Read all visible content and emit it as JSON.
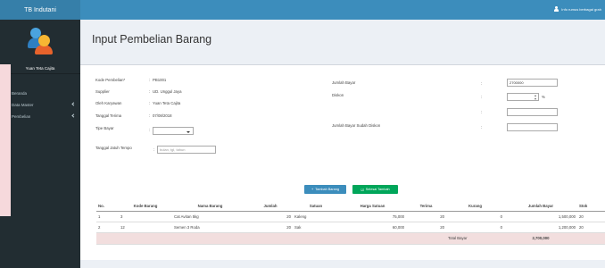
{
  "app": {
    "title": "TB Indutani"
  },
  "topbar": {
    "user": "Info rumus berbagai grah"
  },
  "sidebar": {
    "user_name": "Yuan Teta Cajita",
    "items": [
      {
        "label": "Beranda",
        "icon": "home-icon",
        "has_children": false
      },
      {
        "label": "Data Master",
        "icon": "database-icon",
        "has_children": true
      },
      {
        "label": "Pembelian",
        "icon": "tag-icon",
        "has_children": true
      }
    ]
  },
  "page": {
    "title": "Input Pembelian Barang"
  },
  "form_left": {
    "kode_label": "Kode Pembelian*",
    "kode_value": "PB1001",
    "supplier_label": "Supplier",
    "supplier_value": "UD. Unggul Jaya",
    "oleh_label": "Oleh Karyawan",
    "oleh_value": "Yuan Teta Cajita",
    "tanggal_label": "Tanggal Terima",
    "tanggal_value": "07/08/2018",
    "tipe_label": "Tipe Bayar",
    "tipe_value": "",
    "jatuh_label": "Tanggal Jatuh Tempo",
    "jatuh_placeholder": "bulan, tgl, tahun"
  },
  "form_right": {
    "jumlah_label": "Jumlah Bayar",
    "jumlah_value": "2700000",
    "diskon_label": "Diskon",
    "diskon_value": "",
    "diskon_unit": "%",
    "diskon_amount": "",
    "setelah_label": "Jumlah Bayar Sudah Diskon",
    "setelah_value": ""
  },
  "colon": ":",
  "buttons": {
    "tambah": "Tambah Barang",
    "selesai": "Selesai Tambah"
  },
  "table": {
    "headers": [
      "No.",
      "Kode Barang",
      "Nama Barang",
      "Jumlah",
      "Satuan",
      "Harga Satuan",
      "Terima",
      "Kurang",
      "Jumlah Bayar",
      "Stok"
    ],
    "rows": [
      [
        "1",
        "3",
        "Cat Avitan 5kg",
        "20",
        "Kaleng",
        "75,000",
        "20",
        "0",
        "1,500,000",
        "20"
      ],
      [
        "2",
        "12",
        "Semen 3 Roda",
        "20",
        "Sak",
        "60,000",
        "20",
        "0",
        "1,200,000",
        "20"
      ]
    ],
    "total_label": "Total Bayar",
    "total_value": "2,700,000"
  }
}
